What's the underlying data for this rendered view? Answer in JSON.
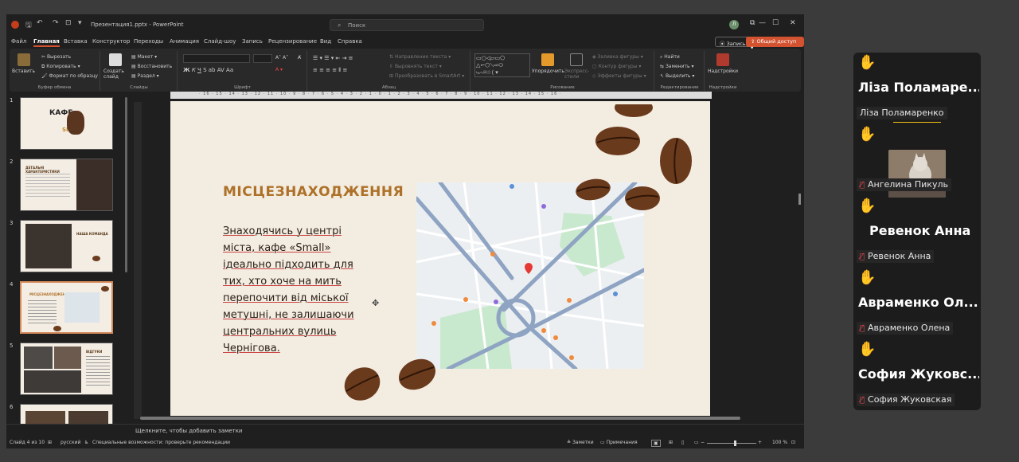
{
  "app": {
    "doc_title": "Презентация1.pptx - PowerPoint",
    "search_placeholder": "Поиск",
    "user_initial": "Л"
  },
  "menu": {
    "tabs": [
      "Файл",
      "Главная",
      "Вставка",
      "Конструктор",
      "Переходы",
      "Анимация",
      "Слайд-шоу",
      "Запись",
      "Рецензирование",
      "Вид",
      "Справка"
    ],
    "record_label": "Запись",
    "share_label": "Общий доступ"
  },
  "ribbon": {
    "clipboard": {
      "paste": "Вставить",
      "cut": "Вырезать",
      "copy": "Копировать",
      "format_painter": "Формат по образцу",
      "title": "Буфер обмена"
    },
    "slides": {
      "new_slide": "Создать слайд",
      "layout": "Макет",
      "reset": "Восстановить",
      "section": "Раздел",
      "title": "Слайды"
    },
    "font": {
      "title": "Шрифт"
    },
    "paragraph": {
      "text_direction": "Направление текста",
      "align_text": "Выровнять текст",
      "smartart": "Преобразовать в SmartArt",
      "title": "Абзац"
    },
    "drawing": {
      "arrange": "Упорядочить",
      "quick_styles": "Экспресс-стили",
      "fill": "Заливка фигуры",
      "outline": "Контур фигуры",
      "effects": "Эффекты фигуры",
      "title": "Рисование"
    },
    "editing": {
      "find": "Найти",
      "replace": "Заменить",
      "select": "Выделить",
      "title": "Редактирование"
    },
    "addins": {
      "label": "Надстройки",
      "title": "Надстройки"
    }
  },
  "thumbnails": [
    {
      "num": "1",
      "caption": "КАФЕ",
      "sub": "SMALL"
    },
    {
      "num": "2",
      "caption": "ДЕТАЛЬНІ ХАРАКТЕРИСТИКИ"
    },
    {
      "num": "3",
      "caption": "НАША КОМАНДА"
    },
    {
      "num": "4",
      "caption": "МІСЦЕЗНАХОДЖЕННЯ"
    },
    {
      "num": "5",
      "caption": "ВІДГУКИ"
    },
    {
      "num": "6",
      "caption": ""
    }
  ],
  "slide": {
    "title": "МІСЦЕЗНАХОДЖЕННЯ",
    "body_lines": [
      "Знаходячись у центрі",
      "міста, кафе «Small»",
      "ідеально підходить для",
      "тих, хто хоче на мить",
      "перепочити від міської",
      "метушні, не залишаючи",
      "центральних вулиць",
      "Чернігова."
    ]
  },
  "notes_placeholder": "Щелкните, чтобы добавить заметки",
  "status": {
    "slide_counter": "Слайд 4 из 10",
    "language": "русский",
    "accessibility": "Специальные возможности: проверьте рекомендации",
    "notes": "Заметки",
    "comments": "Примечания",
    "zoom": "100 %",
    "zoom_level": 0.55
  },
  "participants": [
    {
      "display": "Ліза Поламаре...",
      "label": "Ліза Поламаренко",
      "muted": false,
      "video": false
    },
    {
      "display": "",
      "label": "Ангелина Пикуль",
      "muted": true,
      "video": true
    },
    {
      "display": "Ревенок Анна",
      "label": "Ревенок Анна",
      "muted": true,
      "video": false
    },
    {
      "display": "Авраменко Ол...",
      "label": "Авраменко Олена",
      "muted": true,
      "video": false
    },
    {
      "display": "София Жуковс...",
      "label": "София Жуковская",
      "muted": true,
      "video": false
    }
  ],
  "colors": {
    "accent": "#d35230",
    "slide_title": "#ad7128",
    "hand": "#f5c518"
  }
}
